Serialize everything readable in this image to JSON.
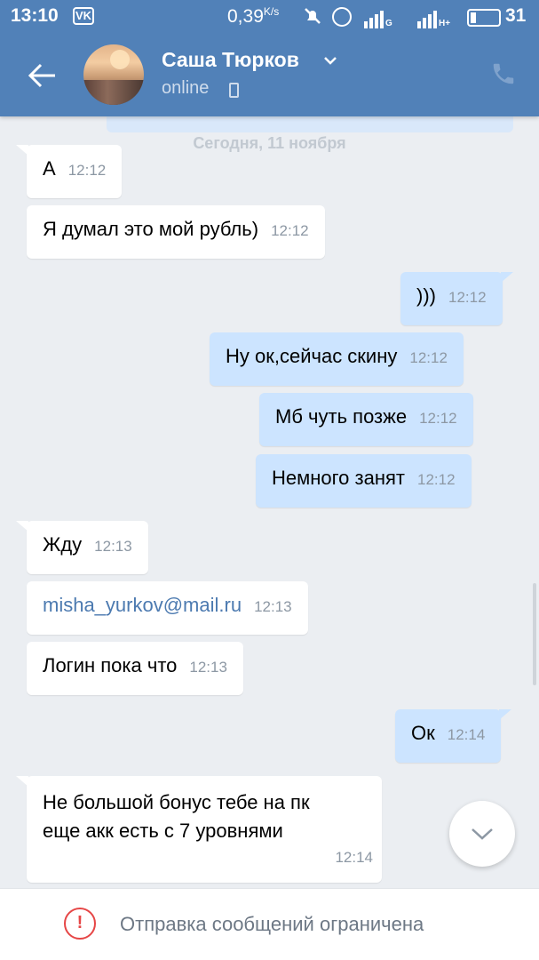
{
  "status_bar": {
    "time": "13:10",
    "app_icon": "VK",
    "net_speed": "0,39",
    "net_speed_unit": "K/s",
    "net1": "G",
    "net2": "H+",
    "battery": "31"
  },
  "toolbar": {
    "contact_name": "Саша Тюрков",
    "status": "online"
  },
  "chat": {
    "date_separator": "Сегодня, 11 ноября",
    "messages": [
      {
        "dir": "in",
        "text": "А",
        "time": "12:12"
      },
      {
        "dir": "in",
        "text": "Я думал это мой рубль)",
        "time": "12:12"
      },
      {
        "dir": "out",
        "text": ")))",
        "time": "12:12"
      },
      {
        "dir": "out",
        "text": "Ну ок,сейчас скину",
        "time": "12:12"
      },
      {
        "dir": "out",
        "text": "Мб чуть позже",
        "time": "12:12"
      },
      {
        "dir": "out",
        "text": "Немного занят",
        "time": "12:12"
      },
      {
        "dir": "in",
        "text": "Жду",
        "time": "12:13"
      },
      {
        "dir": "in",
        "text": "misha_yurkov@mail.ru",
        "time": "12:13"
      },
      {
        "dir": "in",
        "text": "Логин пока что",
        "time": "12:13"
      },
      {
        "dir": "out",
        "text": "Ок",
        "time": "12:14"
      },
      {
        "dir": "in",
        "text_line1": "Не большой бонус тебе на пк",
        "text_line2": "еще акк есть с 7 уровнями",
        "time": "12:14"
      }
    ]
  },
  "footer": {
    "warning_icon": "!",
    "text": "Отправка сообщений ограничена"
  },
  "colors": {
    "header_bg": "#5181b8",
    "incoming_bubble": "#ffffff",
    "outgoing_bubble": "#cce4ff",
    "chat_bg": "#ebeef2",
    "link": "#4c7ab0",
    "warning": "#e64646"
  }
}
